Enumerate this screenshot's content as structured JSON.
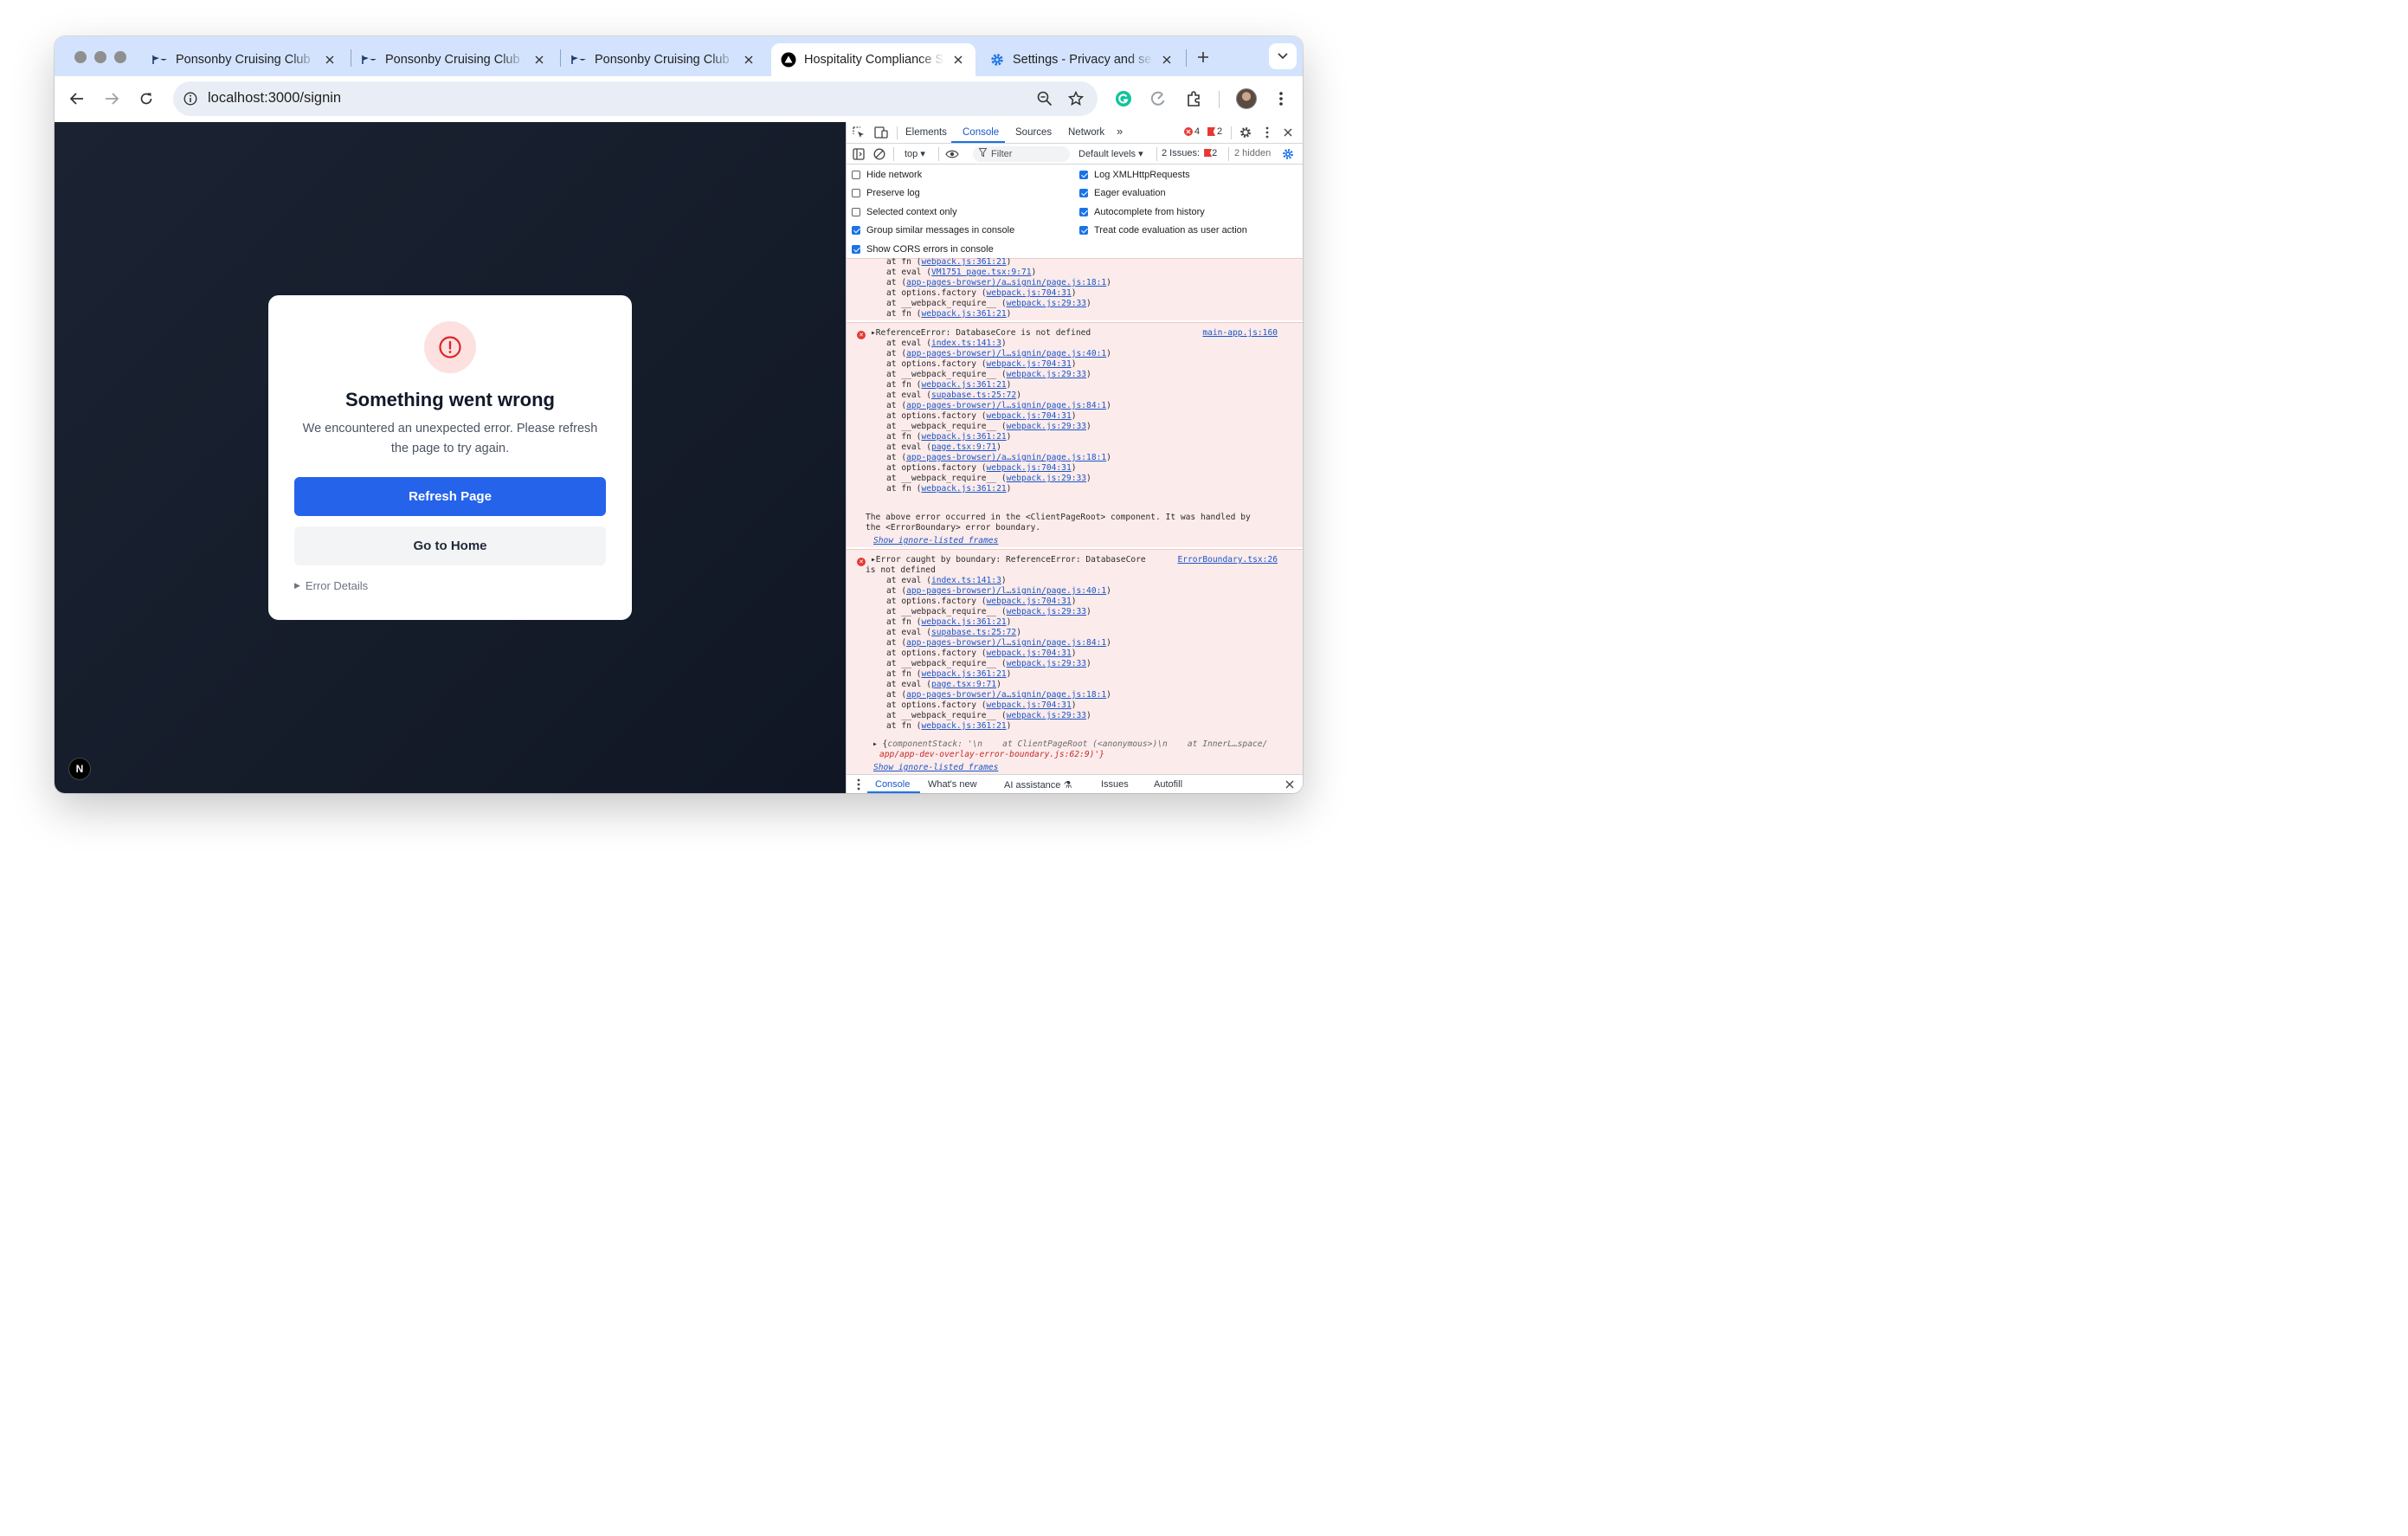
{
  "browser": {
    "tabs": [
      {
        "title": "Ponsonby Cruising Club - ",
        "favicon": "pcc-flag-icon",
        "active": false
      },
      {
        "title": "Ponsonby Cruising Club - ",
        "favicon": "pcc-flag-icon",
        "active": false
      },
      {
        "title": "Ponsonby Cruising Club - ",
        "favicon": "pcc-flag-icon",
        "active": false
      },
      {
        "title": "Hospitality Compliance S",
        "favicon": "vercel-triangle-icon",
        "active": true
      },
      {
        "title": "Settings - Privacy and se",
        "favicon": "settings-gear-icon",
        "active": false
      }
    ],
    "address_url": "localhost:3000/signin"
  },
  "page": {
    "error_title": "Something went wrong",
    "error_message": "We encountered an unexpected error. Please refresh the page to try again.",
    "refresh_button": "Refresh Page",
    "home_button": "Go to Home",
    "details_label": "Error Details",
    "badge_letter": "N"
  },
  "devtools": {
    "tabs": [
      "Elements",
      "Console",
      "Sources",
      "Network"
    ],
    "active_tab": "Console",
    "error_count": "4",
    "issue_count": "2",
    "context": "top",
    "filter_placeholder": "Filter",
    "levels": "Default levels",
    "issues_label": "2 Issues:",
    "issues_count": "2",
    "hidden_label": "2 hidden",
    "settings_left": [
      {
        "label": "Hide network",
        "checked": false
      },
      {
        "label": "Preserve log",
        "checked": false
      },
      {
        "label": "Selected context only",
        "checked": false
      },
      {
        "label": "Group similar messages in console",
        "checked": true
      },
      {
        "label": "Show CORS errors in console",
        "checked": true
      }
    ],
    "settings_right": [
      {
        "label": "Log XMLHttpRequests",
        "checked": true
      },
      {
        "label": "Eager evaluation",
        "checked": true
      },
      {
        "label": "Autocomplete from history",
        "checked": true
      },
      {
        "label": "Treat code evaluation as user action",
        "checked": true
      }
    ],
    "console": {
      "block1_trace": [
        [
          "at fn (",
          "webpack.js:361:21",
          ")"
        ],
        [
          "at eval (",
          "VM1751 page.tsx:9:71",
          ")"
        ],
        [
          "at (",
          "app-pages-browser)/a…signin/page.js:18:1",
          ")"
        ],
        [
          "at options.factory (",
          "webpack.js:704:31",
          ")"
        ],
        [
          "at __webpack_require__ (",
          "webpack.js:29:33",
          ")"
        ],
        [
          "at fn (",
          "webpack.js:361:21",
          ")"
        ]
      ],
      "error2_header": "ReferenceError: DatabaseCore is not defined",
      "error2_source": "main-app.js:160",
      "error2_trace": [
        [
          "at eval (",
          "index.ts:141:3",
          ")"
        ],
        [
          "at (",
          "app-pages-browser)/l…signin/page.js:40:1",
          ")"
        ],
        [
          "at options.factory (",
          "webpack.js:704:31",
          ")"
        ],
        [
          "at __webpack_require__ (",
          "webpack.js:29:33",
          ")"
        ],
        [
          "at fn (",
          "webpack.js:361:21",
          ")"
        ],
        [
          "at eval (",
          "supabase.ts:25:72",
          ")"
        ],
        [
          "at (",
          "app-pages-browser)/l…signin/page.js:84:1",
          ")"
        ],
        [
          "at options.factory (",
          "webpack.js:704:31",
          ")"
        ],
        [
          "at __webpack_require__ (",
          "webpack.js:29:33",
          ")"
        ],
        [
          "at fn (",
          "webpack.js:361:21",
          ")"
        ],
        [
          "at eval (",
          "page.tsx:9:71",
          ")"
        ],
        [
          "at (",
          "app-pages-browser)/a…signin/page.js:18:1",
          ")"
        ],
        [
          "at options.factory (",
          "webpack.js:704:31",
          ")"
        ],
        [
          "at __webpack_require__ (",
          "webpack.js:29:33",
          ")"
        ],
        [
          "at fn (",
          "webpack.js:361:21",
          ")"
        ]
      ],
      "error2_note_1": "The above error occurred in the <ClientPageRoot> component. It was handled by",
      "error2_note_2": "the <ErrorBoundary> error boundary.",
      "show_ignore_listed": "Show ignore-listed frames",
      "error3_header_1": "Error caught by boundary: ReferenceError: DatabaseCore",
      "error3_header_2": "is not defined",
      "error3_source": "ErrorBoundary.tsx:26",
      "error3_trace": [
        [
          "at eval (",
          "index.ts:141:3",
          ")"
        ],
        [
          "at (",
          "app-pages-browser)/l…signin/page.js:40:1",
          ")"
        ],
        [
          "at options.factory (",
          "webpack.js:704:31",
          ")"
        ],
        [
          "at __webpack_require__ (",
          "webpack.js:29:33",
          ")"
        ],
        [
          "at fn (",
          "webpack.js:361:21",
          ")"
        ],
        [
          "at eval (",
          "supabase.ts:25:72",
          ")"
        ],
        [
          "at (",
          "app-pages-browser)/l…signin/page.js:84:1",
          ")"
        ],
        [
          "at options.factory (",
          "webpack.js:704:31",
          ")"
        ],
        [
          "at __webpack_require__ (",
          "webpack.js:29:33",
          ")"
        ],
        [
          "at fn (",
          "webpack.js:361:21",
          ")"
        ],
        [
          "at eval (",
          "page.tsx:9:71",
          ")"
        ],
        [
          "at (",
          "app-pages-browser)/a…signin/page.js:18:1",
          ")"
        ],
        [
          "at options.factory (",
          "webpack.js:704:31",
          ")"
        ],
        [
          "at __webpack_require__ (",
          "webpack.js:29:33",
          ")"
        ],
        [
          "at fn (",
          "webpack.js:361:21",
          ")"
        ]
      ],
      "component_stack_1": "componentStack: '\\n    at ClientPageRoot (<anonymous>)\\n    at InnerL…space/",
      "component_stack_2": "app/app-dev-overlay-error-boundary.js:62:9)'}"
    },
    "drawer_tabs": [
      "Console",
      "What's new",
      "AI assistance",
      "Issues",
      "Autofill"
    ]
  },
  "colors": {
    "page_bg": "#151c2a",
    "primary": "#2563eb",
    "error_red": "#dc2626",
    "tab_strip": "#d3e3fd"
  }
}
